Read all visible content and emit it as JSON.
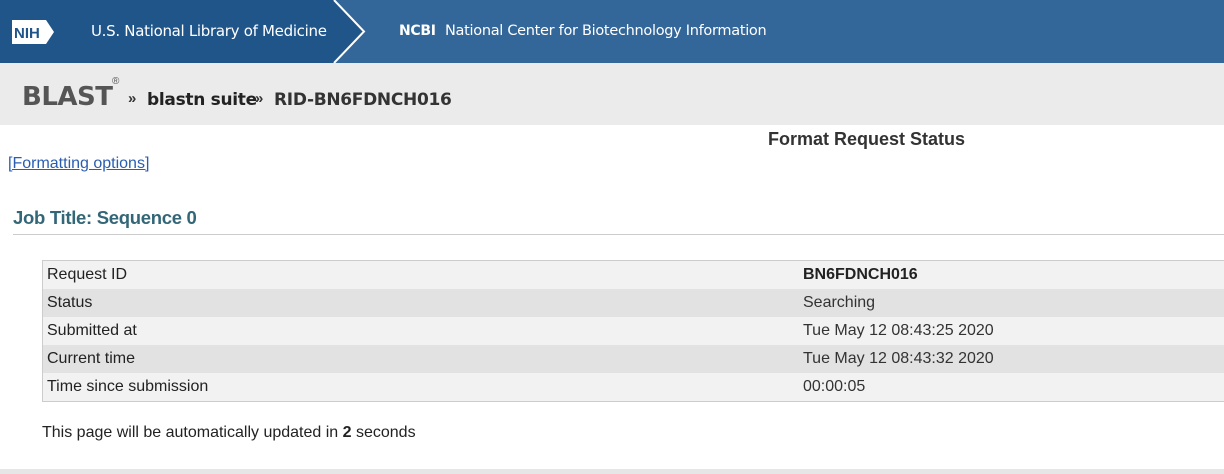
{
  "banner": {
    "nih_logo_text": "NIH",
    "nlm_label": "U.S. National Library of Medicine",
    "ncbi_abbr": "NCBI",
    "ncbi_full": "National Center for Biotechnology Information",
    "colors": {
      "nlm_bg": "#20558a",
      "ncbi_bg": "#336699"
    }
  },
  "breadcrumb": {
    "logo": "BLAST",
    "reg_mark": "®",
    "sep": "»",
    "suite": "blastn suite",
    "rid": "RID-BN6FDNCH016"
  },
  "main": {
    "heading": "Format Request Status",
    "formatting_link": "[Formatting options]",
    "job_title": "Job Title: Sequence 0",
    "status_rows": [
      {
        "label": "Request ID",
        "value": "BN6FDNCH016"
      },
      {
        "label": "Status",
        "value": "Searching"
      },
      {
        "label": "Submitted at",
        "value": "Tue May 12 08:43:25 2020"
      },
      {
        "label": "Current time",
        "value": "Tue May 12 08:43:32 2020"
      },
      {
        "label": "Time since submission",
        "value": "00:00:05"
      }
    ],
    "update_note": {
      "prefix": "This page will be automatically updated in",
      "seconds": "2",
      "suffix": "seconds"
    }
  }
}
